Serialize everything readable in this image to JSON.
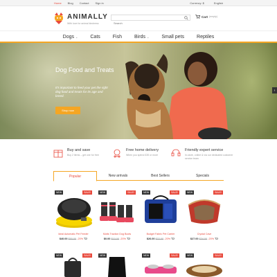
{
  "topbar": {
    "nav": [
      "Home",
      "Blog",
      "Contact",
      "Sign in"
    ],
    "currency": "Currency: $",
    "language": "English"
  },
  "header": {
    "logo_text": "ANIMALLY",
    "tagline": "With love for animal kindness",
    "search_placeholder": "Search",
    "cart_label": "Cart",
    "cart_status": "(empty)"
  },
  "nav": {
    "items": [
      {
        "label": "Dogs",
        "has_dropdown": true
      },
      {
        "label": "Cats",
        "has_dropdown": false
      },
      {
        "label": "Fish",
        "has_dropdown": false
      },
      {
        "label": "Birds",
        "has_dropdown": true
      },
      {
        "label": "Small pets",
        "has_dropdown": false
      },
      {
        "label": "Reptiles",
        "has_dropdown": false
      }
    ]
  },
  "hero": {
    "title": "Dog Food and Treats",
    "text": "It's important to feed your pet the right dog food and treats for its age and breed.",
    "button": "Shop now",
    "next_arrow": "›"
  },
  "features": [
    {
      "icon": "box-icon",
      "title": "Buy and save",
      "desc": "Buy 2 items – get one for free"
    },
    {
      "icon": "delivery-icon",
      "title": "Free home delivery",
      "desc": "When you spend £35 or more"
    },
    {
      "icon": "headset-icon",
      "title": "Friendly expert service",
      "desc": "In-store, online & via our dedicated customer service team"
    }
  ],
  "tabs": [
    "Popular",
    "New arrivals",
    "Best Sellers",
    "Specials"
  ],
  "products": [
    {
      "name": "Ideal Automatic Pet Feeder",
      "price": "$40.00",
      "old_price": "$50.00",
      "discount": "-20%",
      "new_badge": "NEW",
      "sale_badge": "SALE!"
    },
    {
      "name": "Mutts Traction Dog Boots",
      "price": "$0.00",
      "old_price": "$10.00",
      "discount": "-20%",
      "new_badge": "NEW",
      "sale_badge": "SALE!"
    },
    {
      "name": "Budget Fabric Pet Carrier",
      "price": "$26.00",
      "old_price": "$32.00",
      "discount": "-20%",
      "new_badge": "NEW",
      "sale_badge": "SALE!"
    },
    {
      "name": "Crystal Cave",
      "price": "$27.00",
      "old_price": "$34.00",
      "discount": "-20%",
      "new_badge": "NEW",
      "sale_badge": "SALE!"
    }
  ],
  "products_row2": [
    {
      "new_badge": "NEW",
      "sale_badge": "SALE!"
    },
    {
      "new_badge": "NEW",
      "sale_badge": ""
    },
    {
      "new_badge": "NEW",
      "sale_badge": "SALE!"
    },
    {
      "new_badge": "NEW",
      "sale_badge": "SALE!"
    }
  ],
  "colors": {
    "accent": "#f5a623",
    "sale": "#e8493c",
    "dark": "#333333"
  }
}
